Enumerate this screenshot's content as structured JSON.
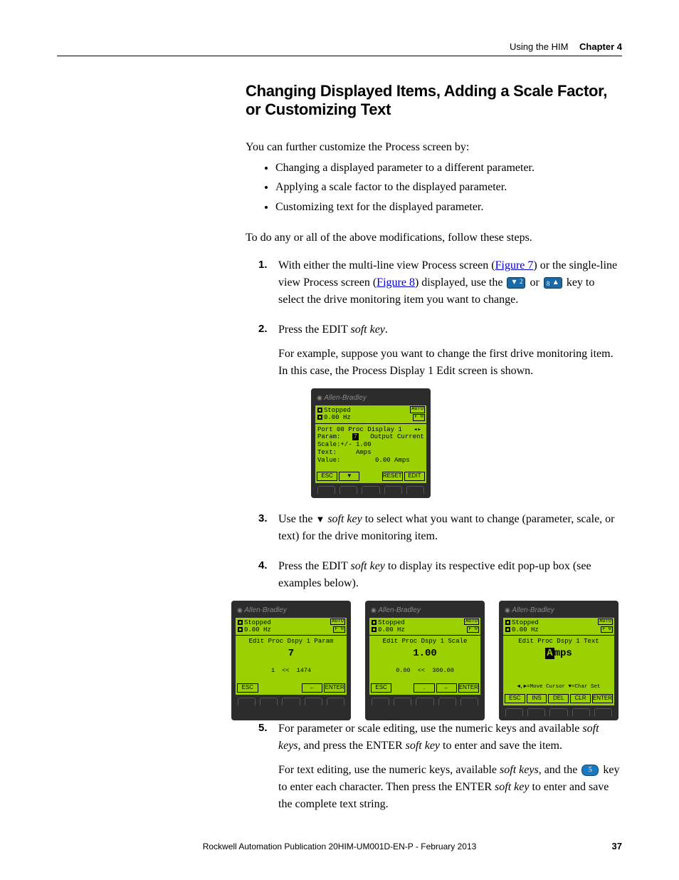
{
  "header": {
    "section": "Using the HIM",
    "chapter": "Chapter 4"
  },
  "title": "Changing Displayed Items, Adding a Scale Factor, or Customizing Text",
  "intro": "You can further customize the Process screen by:",
  "bullets": [
    "Changing a displayed parameter to a different parameter.",
    "Applying a scale factor to the displayed parameter.",
    "Customizing text for the displayed parameter."
  ],
  "lead": "To do any or all of the above modifications, follow these steps.",
  "step1": {
    "pre": "With either the multi-line view Process screen (",
    "fig7": "Figure 7",
    "mid1": ") or the single-line view Process screen (",
    "fig8": "Figure 8",
    "mid2": ") displayed, use the ",
    "or": " or ",
    "post": " key to select the drive monitoring item you want to change."
  },
  "step2": {
    "line": "Press the EDIT ",
    "softkey": "soft key",
    "end": ".",
    "para": "For example, suppose you want to change the first drive monitoring item. In this case, the Process Display 1 Edit screen is shown."
  },
  "step3": {
    "pre": "Use the ",
    "softkey": "soft key",
    "post": " to select what you want to change (parameter, scale, or text) for the drive monitoring item."
  },
  "step4": {
    "pre": "Press the EDIT ",
    "softkey": "soft key",
    "post": " to display its respective edit pop-up box (see examples below)."
  },
  "step5": {
    "p1a": "For parameter or scale editing, use the numeric keys and available ",
    "sk": "soft keys",
    "p1b": ", and press the ENTER ",
    "sk2": "soft key",
    "p1c": " to enter and save the item.",
    "p2a": "For text editing, use the numeric keys, available ",
    "p2b": ", and the ",
    "keydigit": "5",
    "p2c": " key to enter each character. Then press the ENTER ",
    "p2d": " to enter and save the complete text string."
  },
  "him_common": {
    "brand": "Allen-Bradley",
    "stopped": "Stopped",
    "hz": "0.00 Hz",
    "auto": "AUTO",
    "f0": "F 0"
  },
  "him1": {
    "l1": "Port 00 Proc Display 1   ",
    "l2a": "Param:   ",
    "l2inv": "7",
    "l2b": "   Output Current",
    "l3": "Scale:+/- 1.00",
    "l4": "Text:     Amps",
    "l5": "Value:         0.00 Amps",
    "sk": [
      "ESC",
      "▼",
      "",
      "RESET",
      "EDIT"
    ]
  },
  "him2": {
    "title": "Edit Proc Dspy 1 Param",
    "big": "7",
    "range": "1  <<  1474",
    "sk": [
      "ESC",
      "",
      "",
      "←",
      "ENTER"
    ]
  },
  "him3": {
    "title": "Edit Proc Dspy 1 Scale",
    "big": "1.00",
    "range": "0.00  <<  300.00",
    "sk": [
      "ESC",
      "",
      ".",
      "←",
      "ENTER"
    ]
  },
  "him4": {
    "title": "Edit Proc Dspy 1 Text",
    "biginv": "A",
    "bigrest": "mps",
    "hint": "◄,►=Move Cursor ▼=Char Set",
    "sk": [
      "ESC",
      "INS",
      "DEL",
      "CLR",
      "ENTER"
    ]
  },
  "footer": "Rockwell Automation Publication 20HIM-UM001D-EN-P - February 2013",
  "pagenum": "37"
}
